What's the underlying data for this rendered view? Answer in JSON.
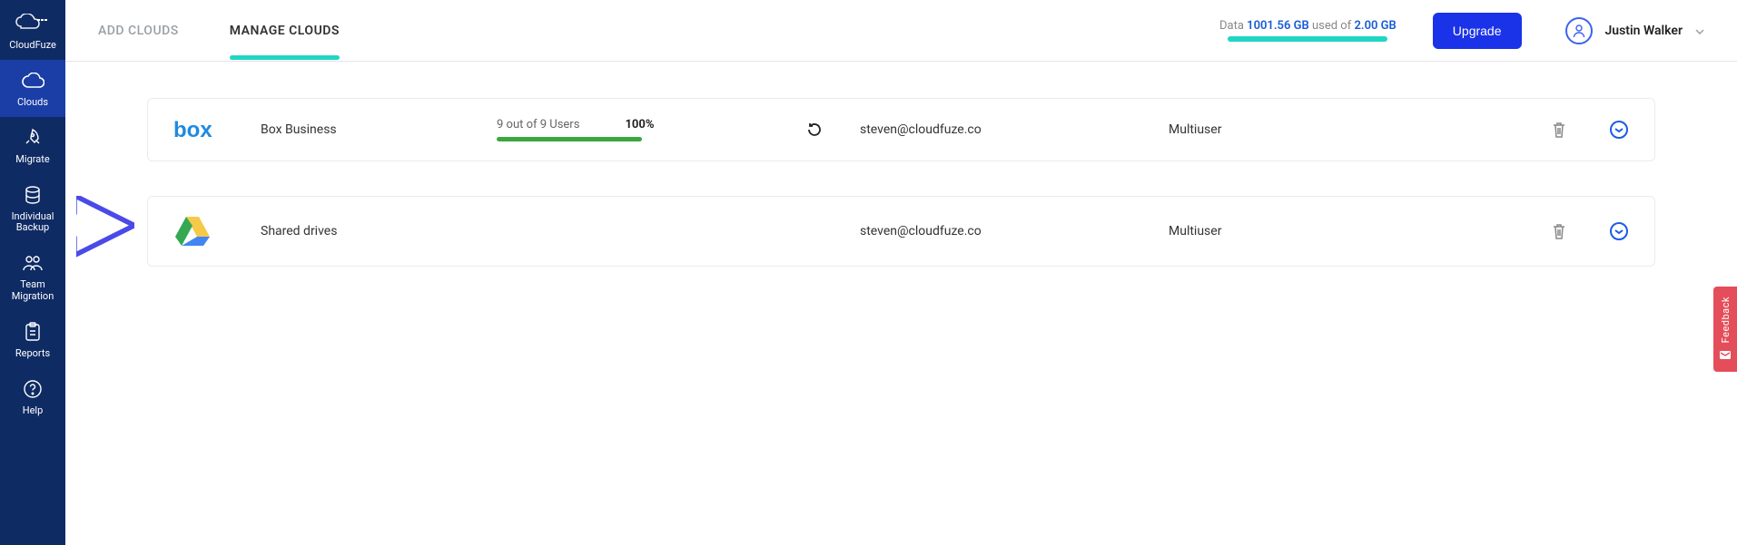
{
  "brand": {
    "name": "CloudFuze"
  },
  "sidebar": {
    "items": [
      {
        "label": "Clouds"
      },
      {
        "label": "Migrate"
      },
      {
        "label": "Individual\nBackup"
      },
      {
        "label": "Team\nMigration"
      },
      {
        "label": "Reports"
      },
      {
        "label": "Help"
      }
    ]
  },
  "header": {
    "tabs": [
      {
        "label": "ADD CLOUDS"
      },
      {
        "label": "MANAGE CLOUDS"
      }
    ],
    "usage": {
      "prefix": "Data ",
      "used": "1001.56 GB",
      "middle": " used of ",
      "total": "2.00 GB"
    },
    "upgrade_label": "Upgrade",
    "user_name": "Justin Walker"
  },
  "clouds": [
    {
      "name": "Box Business",
      "users_text": "9 out of 9 Users",
      "percent": "100%",
      "email": "steven@cloudfuze.co",
      "type": "Multiuser"
    },
    {
      "name": "Shared drives",
      "users_text": "",
      "percent": "",
      "email": "steven@cloudfuze.co",
      "type": "Multiuser"
    }
  ],
  "feedback_label": "Feedback"
}
